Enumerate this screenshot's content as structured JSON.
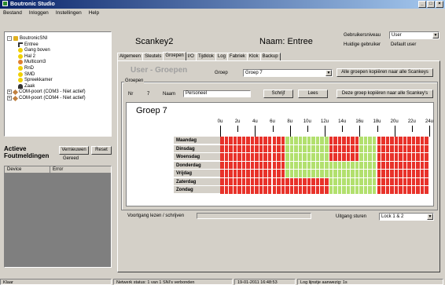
{
  "window": {
    "title": "Boutronic Studio",
    "min": "_",
    "max": "□",
    "close": "×"
  },
  "menu": [
    "Bestand",
    "Inloggen",
    "Instellingen",
    "Help"
  ],
  "tree": [
    {
      "label": "BoutronicSNI",
      "level": 0,
      "icon": "server-icon",
      "expander": "-"
    },
    {
      "label": "Entree",
      "level": 2,
      "icon": "entrance-icon"
    },
    {
      "label": "Gang boven",
      "level": 2,
      "icon": "bulb-icon"
    },
    {
      "label": "Hal 2",
      "level": 2,
      "icon": "bulb-icon"
    },
    {
      "label": "Multicom3",
      "level": 2,
      "icon": "multicom-icon"
    },
    {
      "label": "RnD",
      "level": 2,
      "icon": "bulb-icon"
    },
    {
      "label": "SMD",
      "level": 2,
      "icon": "bulb-icon"
    },
    {
      "label": "Spreekkamer",
      "level": 2,
      "icon": "bulb-icon"
    },
    {
      "label": "Zaak",
      "level": 2,
      "icon": "zone-icon"
    },
    {
      "label": "COM-poort (COM3 - Niet actief)",
      "level": 0,
      "icon": "port-icon",
      "expander": "+"
    },
    {
      "label": "COM-poort (COM4 - Niet actief)",
      "level": 0,
      "icon": "port-icon",
      "expander": "+"
    }
  ],
  "errors": {
    "title": "Actieve Foutmeldingen",
    "refresh": "Vernieuwen",
    "reset": "Reset",
    "status": "Gereed",
    "col_device": "Device",
    "col_error": "Error"
  },
  "header": {
    "device": "Scankey2",
    "name": "Naam: Entree",
    "level_label": "Gebruikersniveau",
    "level_value": "User",
    "current_label": "Huidige gebruiker",
    "current_value": "Default user"
  },
  "tabs": [
    "Algemeen",
    "Sleutels",
    "Groepen",
    "I/O",
    "Tijdklok",
    "Log",
    "Fabriek",
    "Klok",
    "Backup"
  ],
  "active_tab": 2,
  "panel": {
    "heading": "User - Groepen",
    "group_label": "Groep",
    "group_value": "Groep 7",
    "copy_all": "Alle groepen kopiëren naar alle Scankeys",
    "groupbox": "Groepen",
    "nr_label": "Nr",
    "nr_value": "7",
    "naam_label": "Naam",
    "naam_value": "Personeel",
    "write": "Schrijf",
    "read": "Lees",
    "copy_one": "Deze groep kopiëren naar alle Scankey's"
  },
  "schedule": {
    "title": "Groep 7",
    "hours": [
      "0u",
      "2u",
      "4u",
      "6u",
      "8u",
      "10u",
      "12u",
      "14u",
      "16u",
      "18u",
      "20u",
      "22u",
      "24u"
    ],
    "days": [
      "Maandag",
      "Dinsdag",
      "Woensdag",
      "Donderdag",
      "Vrijdag",
      "Zaterdag",
      "Zondag"
    ],
    "allowed_windows_hours": [
      [
        [
          7.5,
          12.5
        ],
        [
          16,
          18
        ]
      ],
      [
        [
          7.5,
          12.5
        ],
        [
          16,
          18
        ]
      ],
      [
        [
          7.5,
          12.5
        ],
        [
          16,
          18
        ]
      ],
      [
        [
          7.5,
          18
        ]
      ],
      [
        [
          7.5,
          18
        ]
      ],
      [
        [
          12.5,
          18
        ]
      ],
      [
        [
          12.5,
          18
        ]
      ]
    ],
    "allowed_color": "#b2e06e",
    "blocked_color": "#e8322a"
  },
  "progress": {
    "label": "Voortgang lezen / schrijven",
    "value": 0
  },
  "output": {
    "label": "Uitgang sturen",
    "value": "Lock 1 & 2"
  },
  "status": {
    "state": "Klaar",
    "network": "Netwerk status: 1 van 1 SNI's verbonden",
    "datetime": "19-01-2011 16:48:53",
    "log": "Log lijnstje aanwezig: 1s"
  }
}
